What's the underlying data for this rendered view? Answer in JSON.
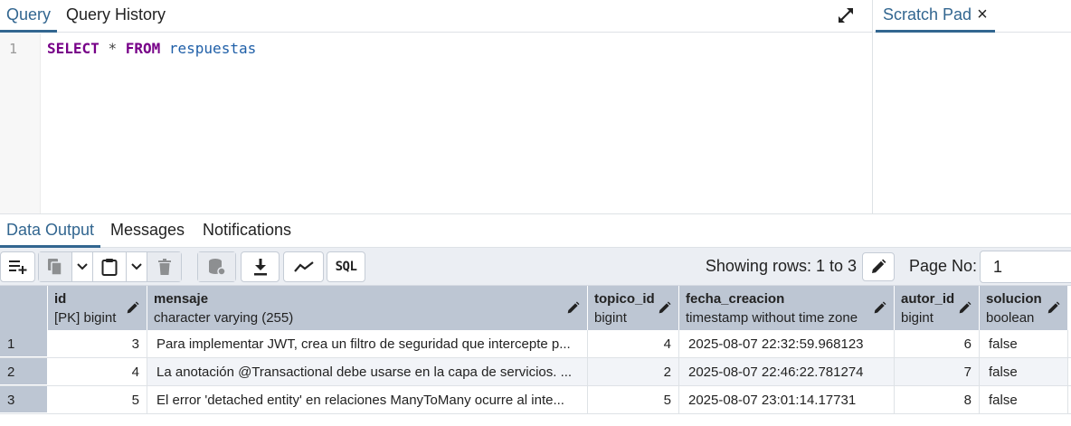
{
  "editor": {
    "tabs": [
      {
        "label": "Query"
      },
      {
        "label": "Query History"
      }
    ],
    "line_number": "1",
    "code": {
      "kw_select": "SELECT",
      "op_star": "*",
      "kw_from": "FROM",
      "table": "respuestas"
    }
  },
  "scratch": {
    "tab_label": "Scratch Pad",
    "close": "×"
  },
  "output": {
    "tabs": [
      {
        "label": "Data Output"
      },
      {
        "label": "Messages"
      },
      {
        "label": "Notifications"
      }
    ],
    "toolbar": {
      "sql_label": "SQL"
    },
    "rows_label": "Showing rows: 1 to 3",
    "page_label": "Page No:",
    "page_value": "1"
  },
  "grid": {
    "columns": [
      {
        "name": "id",
        "type": "[PK] bigint"
      },
      {
        "name": "mensaje",
        "type": "character varying (255)"
      },
      {
        "name": "topico_id",
        "type": "bigint"
      },
      {
        "name": "fecha_creacion",
        "type": "timestamp without time zone"
      },
      {
        "name": "autor_id",
        "type": "bigint"
      },
      {
        "name": "solucion",
        "type": "boolean"
      }
    ],
    "rows": [
      {
        "num": "1",
        "id": "3",
        "mensaje": "Para implementar JWT, crea un filtro de seguridad que intercepte p...",
        "topico_id": "4",
        "fecha_creacion": "2025-08-07 22:32:59.968123",
        "autor_id": "6",
        "solucion": "false"
      },
      {
        "num": "2",
        "id": "4",
        "mensaje": "La anotación @Transactional debe usarse en la capa de servicios. ...",
        "topico_id": "2",
        "fecha_creacion": "2025-08-07 22:46:22.781274",
        "autor_id": "7",
        "solucion": "false"
      },
      {
        "num": "3",
        "id": "5",
        "mensaje": "El error 'detached entity' en relaciones ManyToMany ocurre al inte...",
        "topico_id": "5",
        "fecha_creacion": "2025-08-07 23:01:14.17731",
        "autor_id": "8",
        "solucion": "false"
      }
    ]
  },
  "colors": {
    "accent": "#326690",
    "header_bg": "#bdc6d3",
    "keyword": "#770088",
    "identifier": "#1f5fa8"
  }
}
